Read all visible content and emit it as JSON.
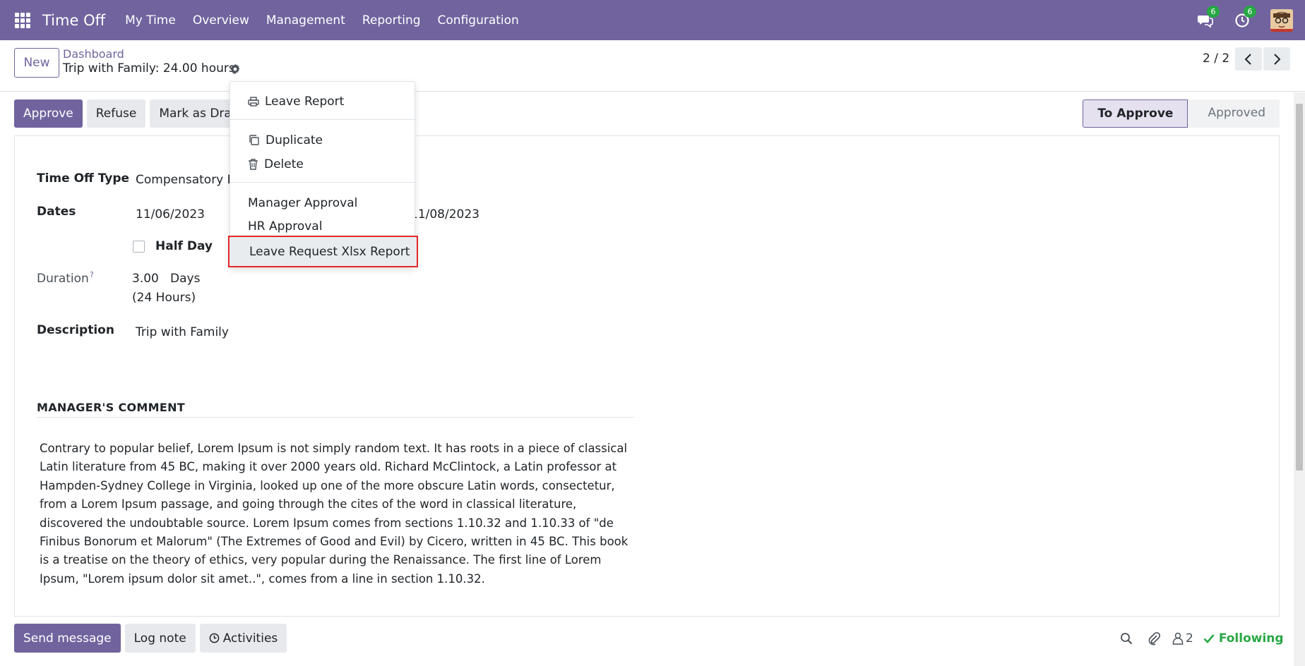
{
  "navbar": {
    "app_name": "Time Off",
    "menu": [
      "My Time",
      "Overview",
      "Management",
      "Reporting",
      "Configuration"
    ],
    "messages_count": "6",
    "activities_count": "6"
  },
  "control_panel": {
    "new_label": "New",
    "breadcrumb_parent": "Dashboard",
    "breadcrumb_current": "Trip with Family: 24.00 hours",
    "pager": "2 / 2"
  },
  "actions": {
    "approve": "Approve",
    "refuse": "Refuse",
    "mark_as_draft": "Mark as Draft"
  },
  "stages": {
    "active": "To Approve",
    "next": "Approved"
  },
  "form": {
    "time_off_type_label": "Time Off Type",
    "time_off_type_value": "Compensatory Days",
    "dates_label": "Dates",
    "date_from": "11/06/2023",
    "date_to": "11/08/2023",
    "half_day_label": "Half Day",
    "duration_label": "Duration",
    "duration_help": "?",
    "duration_value": "3.00",
    "duration_unit": "Days",
    "duration_hours": "(24 Hours)",
    "description_label": "Description",
    "description_value": "Trip with Family"
  },
  "managers_comment": {
    "title": "MANAGER'S COMMENT",
    "text": "Contrary to popular belief, Lorem Ipsum is not simply random text. It has roots in a piece of classical Latin literature from 45 BC, making it over 2000 years old. Richard McClintock, a Latin professor at Hampden-Sydney College in Virginia, looked up one of the more obscure Latin words, consectetur, from a Lorem Ipsum passage, and going through the cites of the word in classical literature, discovered the undoubtable source. Lorem Ipsum comes from sections 1.10.32 and 1.10.33 of \"de Finibus Bonorum et Malorum\" (The Extremes of Good and Evil) by Cicero, written in 45 BC. This book is a treatise on the theory of ethics, very popular during the Renaissance. The first line of Lorem Ipsum, \"Lorem ipsum dolor sit amet..\", comes from a line in section 1.10.32."
  },
  "dropdown": {
    "leave_report": "Leave Report",
    "duplicate": "Duplicate",
    "delete": "Delete",
    "manager_approval": "Manager Approval",
    "hr_approval": "HR Approval",
    "xlsx_report": "Leave Request Xlsx Report"
  },
  "chatter": {
    "send_message": "Send message",
    "log_note": "Log note",
    "activities": "Activities",
    "followers_count": "2",
    "following": "Following"
  },
  "colors": {
    "brand": "#71639e",
    "success": "#28a745",
    "highlight_border": "#e22828"
  }
}
